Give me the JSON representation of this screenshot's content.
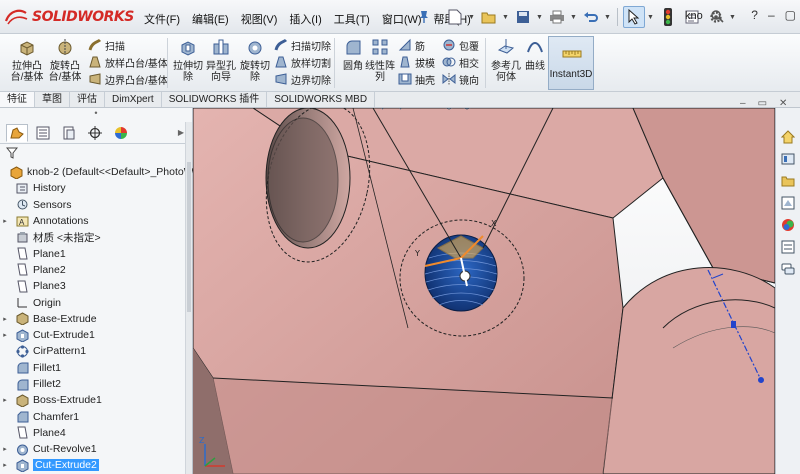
{
  "app": {
    "logo_solid": "SOLID",
    "logo_works": "WORKS",
    "user": "kno"
  },
  "menu": [
    "文件(F)",
    "编辑(E)",
    "视图(V)",
    "插入(I)",
    "工具(T)",
    "窗口(W)",
    "帮助(H)"
  ],
  "ribbon": {
    "extrude_boss": "拉伸凸\n台/基体",
    "revolve_boss": "旋转凸\n台/基体",
    "sweep": "扫描",
    "loft_boss": "放样凸台/基体",
    "boundary_boss": "边界凸台/基体",
    "extrude_cut": "拉伸切\n除",
    "hole_wizard": "异型孔\n向导",
    "revolve_cut": "旋转切\n除",
    "swept_cut": "扫描切除",
    "lofted_cut": "放样切割",
    "boundary_cut": "边界切除",
    "fillet": "圆角",
    "linear_pattern": "线性阵\n列",
    "rib": "筋",
    "draft": "拔模",
    "shell": "抽壳",
    "wrap": "包覆",
    "intersect": "相交",
    "mirror": "镜向",
    "ref_geometry": "参考几\n何体",
    "curves": "曲线",
    "instant3d": "Instant3D"
  },
  "tabs": [
    "特征",
    "草图",
    "评估",
    "DimXpert",
    "SOLIDWORKS 插件",
    "SOLIDWORKS MBD"
  ],
  "active_tab": 0,
  "tree": {
    "root": "knob-2  (Default<<Default>_PhotoWor",
    "items": [
      {
        "label": "History",
        "icon": "history-icon",
        "expand": ""
      },
      {
        "label": "Sensors",
        "icon": "sensors-icon",
        "expand": ""
      },
      {
        "label": "Annotations",
        "icon": "annotations-icon",
        "expand": "▸"
      },
      {
        "label": "材质 <未指定>",
        "icon": "material-icon",
        "expand": ""
      },
      {
        "label": "Plane1",
        "icon": "plane-icon",
        "expand": ""
      },
      {
        "label": "Plane2",
        "icon": "plane-icon",
        "expand": ""
      },
      {
        "label": "Plane3",
        "icon": "plane-icon",
        "expand": ""
      },
      {
        "label": "Origin",
        "icon": "origin-icon",
        "expand": ""
      },
      {
        "label": "Base-Extrude",
        "icon": "extrude-feature-icon",
        "expand": "▸"
      },
      {
        "label": "Cut-Extrude1",
        "icon": "cut-extrude-icon",
        "expand": "▸"
      },
      {
        "label": "CirPattern1",
        "icon": "circular-pattern-icon",
        "expand": ""
      },
      {
        "label": "Fillet1",
        "icon": "fillet-icon",
        "expand": ""
      },
      {
        "label": "Fillet2",
        "icon": "fillet-icon",
        "expand": ""
      },
      {
        "label": "Boss-Extrude1",
        "icon": "extrude-feature-icon",
        "expand": "▸"
      },
      {
        "label": "Chamfer1",
        "icon": "chamfer-icon",
        "expand": ""
      },
      {
        "label": "Plane4",
        "icon": "plane-icon",
        "expand": ""
      },
      {
        "label": "Cut-Revolve1",
        "icon": "cut-revolve-icon",
        "expand": "▸"
      },
      {
        "label": "Cut-Extrude2",
        "icon": "cut-extrude-icon",
        "expand": "▸"
      }
    ],
    "selected_index": 17
  },
  "colors": {
    "part_pink": "#d9a7a3",
    "selected_face": "#1f4f9e",
    "accent": "#3399ff",
    "brand_red": "#d42a26"
  }
}
